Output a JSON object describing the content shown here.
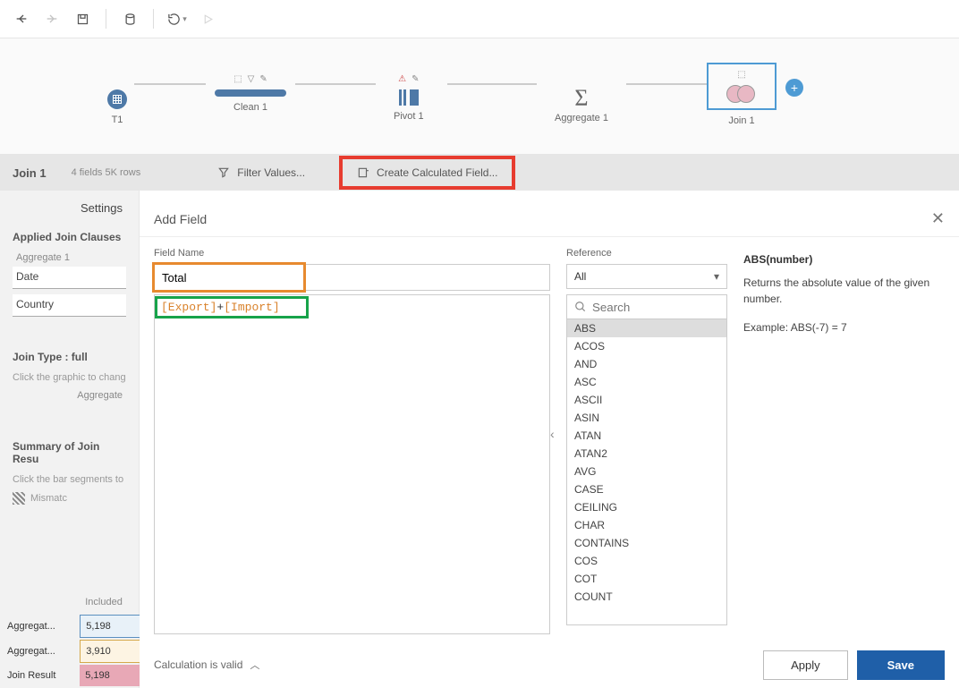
{
  "toolbar": {},
  "flow": {
    "nodes": [
      "T1",
      "Clean 1",
      "Pivot 1",
      "Aggregate 1",
      "Join 1"
    ]
  },
  "secondary": {
    "title": "Join 1",
    "meta": "4 fields   5K rows",
    "filter_label": "Filter Values...",
    "calc_label": "Create Calculated Field..."
  },
  "settings": {
    "tab": "Settings",
    "applied": "Applied Join Clauses",
    "agg_label": "Aggregate 1",
    "clauses": [
      "Date",
      "Country"
    ],
    "join_type": "Join Type : full",
    "click_graphic": "Click the graphic to chang",
    "agg_small": "Aggregate ",
    "summary": "Summary of Join Resu",
    "click_bars": "Click the bar segments to",
    "mismatch": "Mismatc",
    "table": {
      "header": "Included",
      "rows": [
        {
          "label": "Aggregat...",
          "val": "5,198"
        },
        {
          "label": "Aggregat...",
          "val": "3,910"
        },
        {
          "label": "Join Result",
          "val": "5,198"
        }
      ]
    }
  },
  "modal": {
    "title": "Add Field",
    "field_name_label": "Field Name",
    "field_name_value": "Total",
    "formula": {
      "f1": "[Export]",
      "op": "+",
      "f2": "[Import]"
    },
    "reference_label": "Reference",
    "ref_select": "All",
    "search_placeholder": "Search",
    "functions": [
      "ABS",
      "ACOS",
      "AND",
      "ASC",
      "ASCII",
      "ASIN",
      "ATAN",
      "ATAN2",
      "AVG",
      "CASE",
      "CEILING",
      "CHAR",
      "CONTAINS",
      "COS",
      "COT",
      "COUNT"
    ],
    "help": {
      "title": "ABS(number)",
      "desc": "Returns the absolute value of the given number.",
      "example": "Example: ABS(-7) = 7"
    },
    "valid_msg": "Calculation is valid",
    "apply": "Apply",
    "save": "Save"
  }
}
